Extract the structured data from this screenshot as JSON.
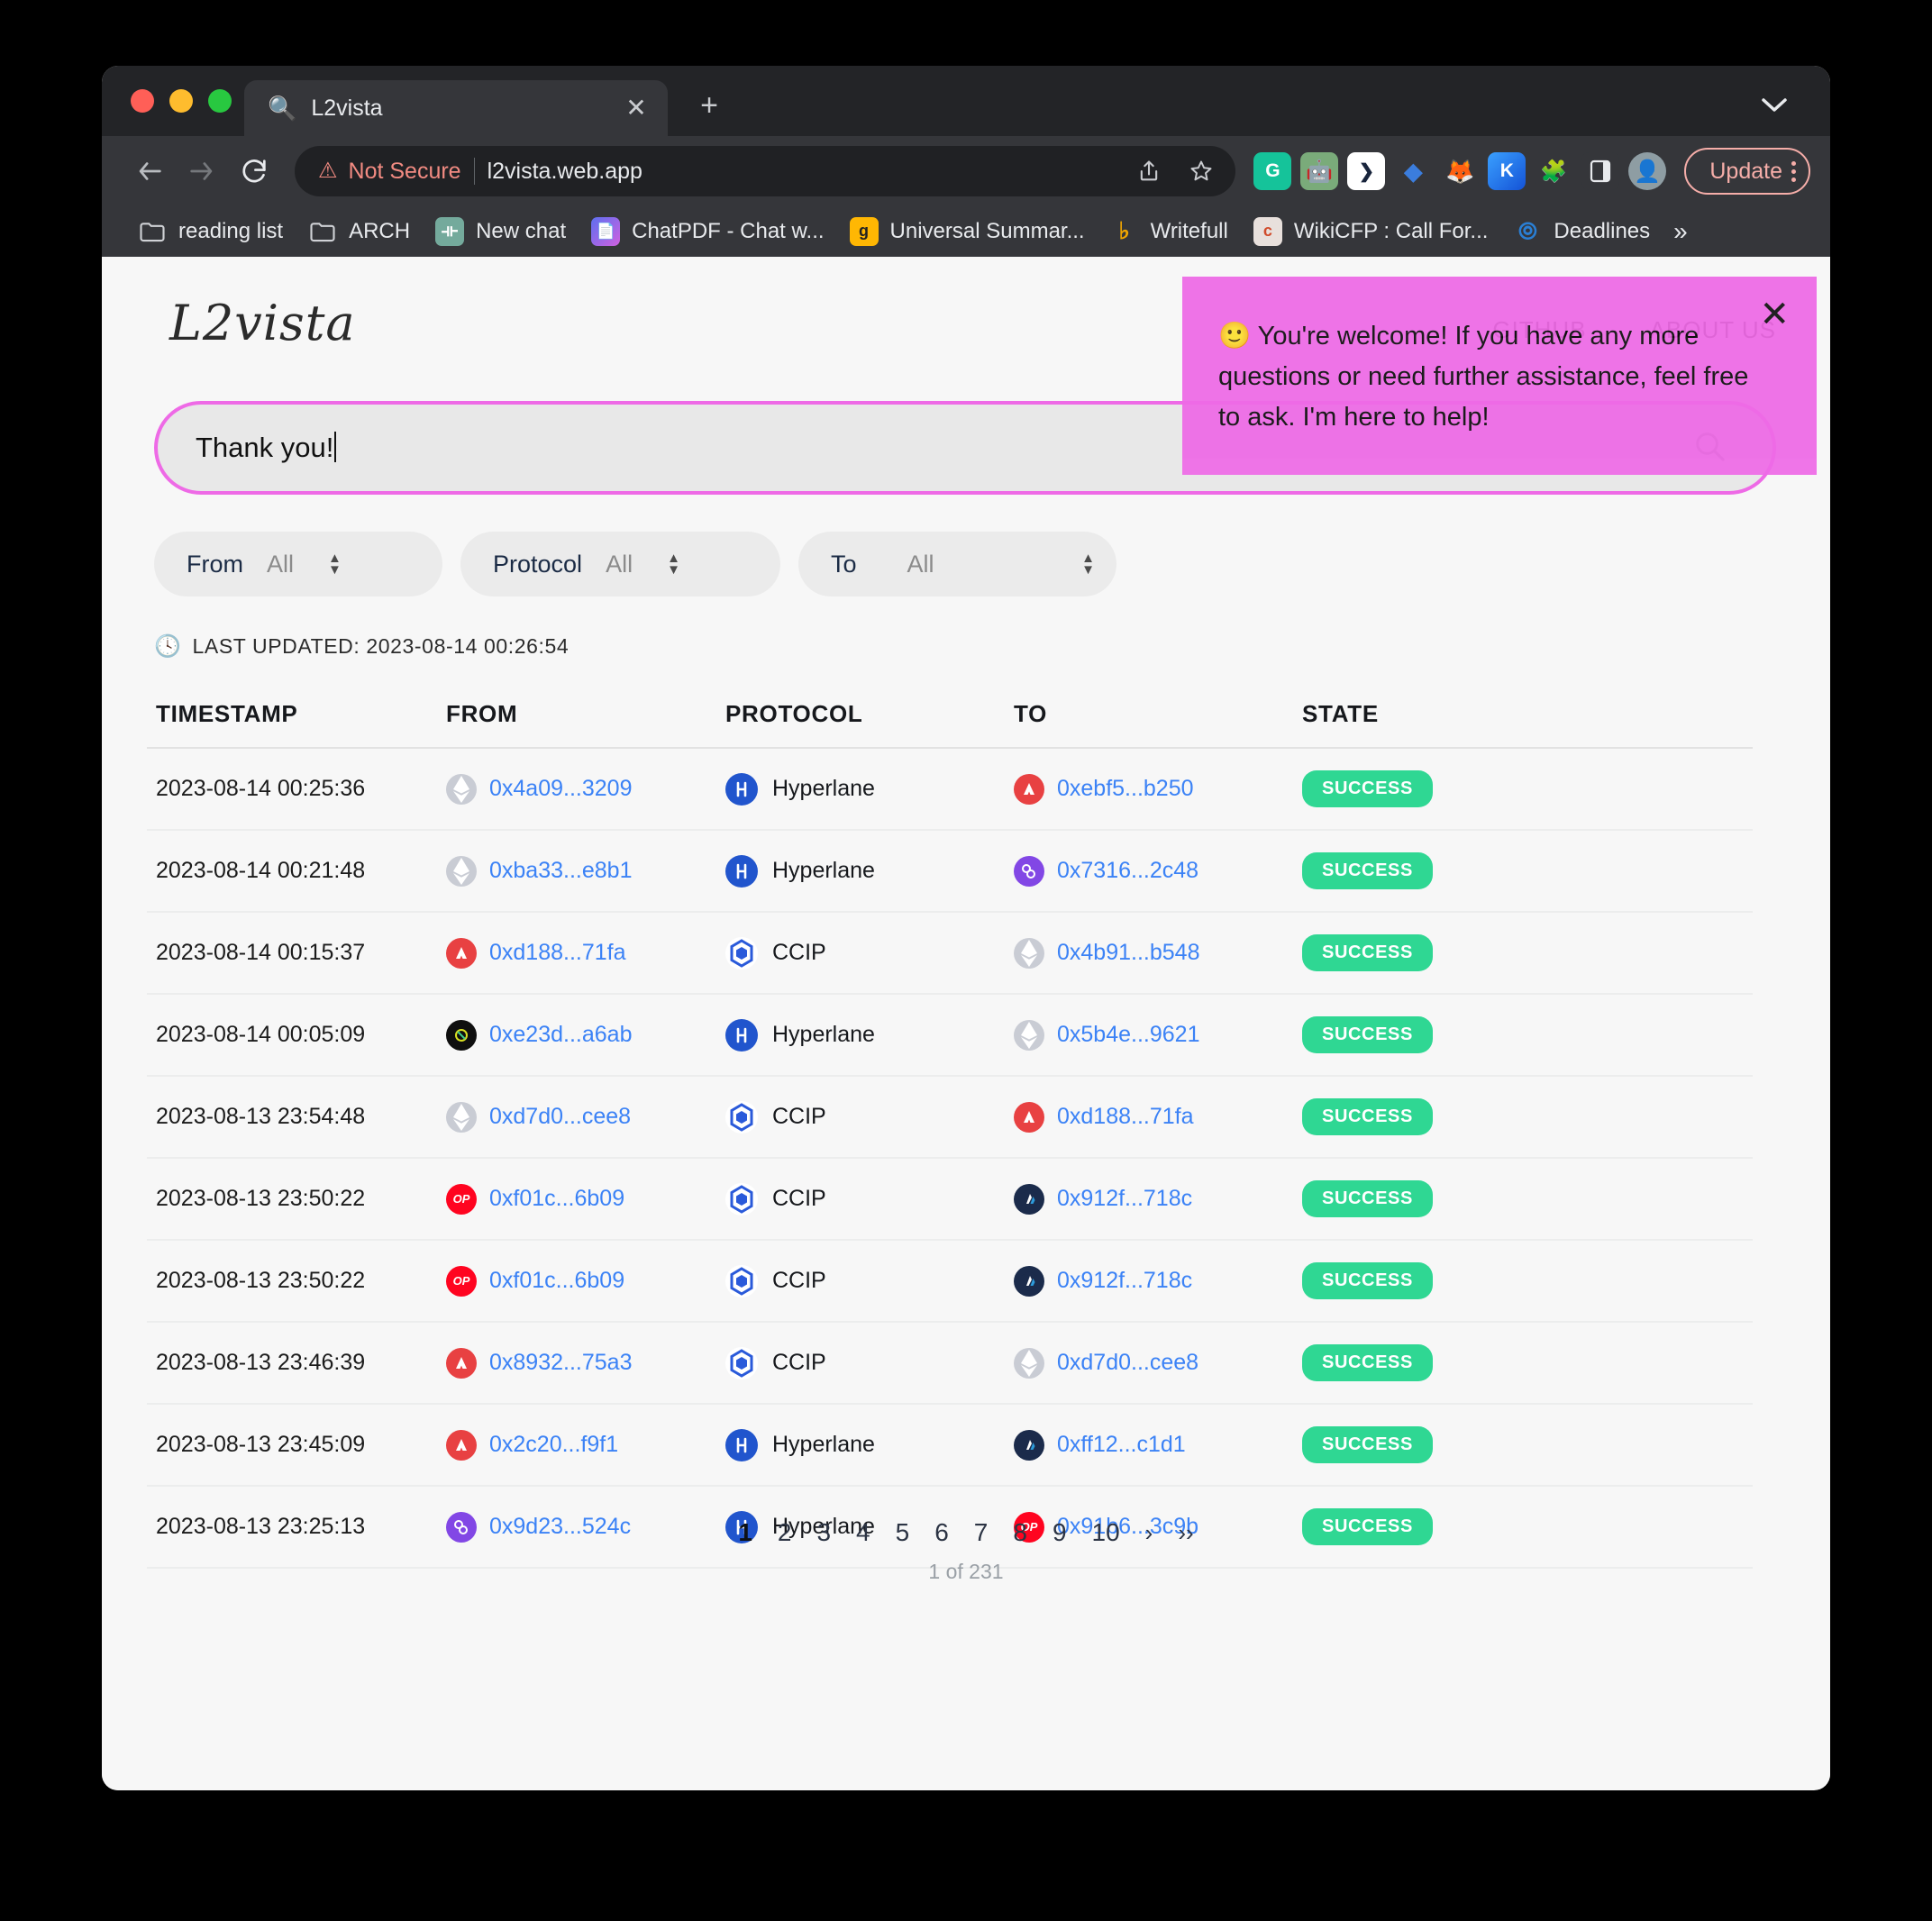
{
  "browser": {
    "tab": {
      "title": "L2vista",
      "favicon": "magnifier-icon",
      "close_label": "✕"
    },
    "new_tab_label": "+",
    "omnibox": {
      "security_label": "Not Secure",
      "warning_icon": "⚠",
      "url": "l2vista.web.app"
    },
    "nav": {
      "back": "←",
      "forward": "→",
      "reload": "↻"
    },
    "update_button": "Update",
    "extensions": [
      {
        "name": "grammarly-extension",
        "glyph": "G",
        "bg": "#15c39a"
      },
      {
        "name": "chatbot-extension",
        "glyph": "🤖",
        "bg": "#6aa06a"
      },
      {
        "name": "scribe-extension",
        "glyph": "❯",
        "bg": "#ffffff",
        "fg": "#1c2b4a"
      },
      {
        "name": "diamond-extension",
        "glyph": "◆",
        "bg": "#35363a",
        "fg": "#3b7ddd"
      },
      {
        "name": "metamask-extension",
        "glyph": "🦊",
        "bg": "#35363a"
      },
      {
        "name": "kaggle-extension",
        "glyph": "K",
        "bg": "#2d7ff9"
      },
      {
        "name": "puzzle-extensions-icon",
        "glyph": "🧩",
        "bg": "#35363a"
      },
      {
        "name": "sidepanel-icon",
        "glyph": "▯",
        "bg": "#35363a"
      },
      {
        "name": "profile-avatar",
        "glyph": "👤",
        "bg": "#8a9aa0"
      }
    ],
    "bookmarks": [
      {
        "label": "reading list",
        "icon": "folder-icon",
        "glyph": "🗀",
        "bg": "transparent"
      },
      {
        "label": "ARCH",
        "icon": "folder-icon",
        "glyph": "🗀",
        "bg": "transparent"
      },
      {
        "label": "New chat",
        "icon": "openai-icon",
        "glyph": "⊛",
        "bg": "#74aa9c"
      },
      {
        "label": "ChatPDF - Chat w...",
        "icon": "chatpdf-icon",
        "glyph": "📄",
        "bg": "#c86bdc"
      },
      {
        "label": "Universal Summar...",
        "icon": "glasp-icon",
        "glyph": "g",
        "bg": "#ffb703"
      },
      {
        "label": "Writefull",
        "icon": "writefull-icon",
        "glyph": "W",
        "bg": "#f0a500"
      },
      {
        "label": "WikiCFP : Call For...",
        "icon": "wikicfp-icon",
        "glyph": "c",
        "bg": "#e8e0dc"
      },
      {
        "label": "Deadlines",
        "icon": "deadlines-icon",
        "glyph": "◆",
        "bg": "#2a7fd4"
      }
    ],
    "bookmarks_overflow": "»"
  },
  "site": {
    "brand": "L2vista",
    "nav": [
      "GITHUB",
      "ABOUT US"
    ],
    "search": {
      "value": "Thank you!",
      "icon": "search-icon"
    },
    "filters": [
      {
        "label": "From",
        "value": "All"
      },
      {
        "label": "Protocol",
        "value": "All"
      },
      {
        "label": "To",
        "value": "All"
      }
    ],
    "last_updated": "LAST UPDATED: 2023-08-14 00:26:54",
    "clock_icon": "🕓"
  },
  "table": {
    "columns": [
      "TIMESTAMP",
      "FROM",
      "PROTOCOL",
      "TO",
      "STATE"
    ],
    "rows": [
      {
        "timestamp": "2023-08-14 00:25:36",
        "from": {
          "addr": "0x4a09...3209",
          "chain": "ethereum"
        },
        "protocol": {
          "name": "Hyperlane",
          "icon": "hyperlane-icon"
        },
        "to": {
          "addr": "0xebf5...b250",
          "chain": "avalanche"
        },
        "state": "SUCCESS"
      },
      {
        "timestamp": "2023-08-14 00:21:48",
        "from": {
          "addr": "0xba33...e8b1",
          "chain": "ethereum"
        },
        "protocol": {
          "name": "Hyperlane",
          "icon": "hyperlane-icon"
        },
        "to": {
          "addr": "0x7316...2c48",
          "chain": "polygon"
        },
        "state": "SUCCESS"
      },
      {
        "timestamp": "2023-08-14 00:15:37",
        "from": {
          "addr": "0xd188...71fa",
          "chain": "avalanche"
        },
        "protocol": {
          "name": "CCIP",
          "icon": "ccip-icon"
        },
        "to": {
          "addr": "0x4b91...b548",
          "chain": "ethereum"
        },
        "state": "SUCCESS"
      },
      {
        "timestamp": "2023-08-14 00:05:09",
        "from": {
          "addr": "0xe23d...a6ab",
          "chain": "gnosis"
        },
        "protocol": {
          "name": "Hyperlane",
          "icon": "hyperlane-icon"
        },
        "to": {
          "addr": "0x5b4e...9621",
          "chain": "ethereum"
        },
        "state": "SUCCESS"
      },
      {
        "timestamp": "2023-08-13 23:54:48",
        "from": {
          "addr": "0xd7d0...cee8",
          "chain": "ethereum"
        },
        "protocol": {
          "name": "CCIP",
          "icon": "ccip-icon"
        },
        "to": {
          "addr": "0xd188...71fa",
          "chain": "avalanche"
        },
        "state": "SUCCESS"
      },
      {
        "timestamp": "2023-08-13 23:50:22",
        "from": {
          "addr": "0xf01c...6b09",
          "chain": "optimism"
        },
        "protocol": {
          "name": "CCIP",
          "icon": "ccip-icon"
        },
        "to": {
          "addr": "0x912f...718c",
          "chain": "arbitrum"
        },
        "state": "SUCCESS"
      },
      {
        "timestamp": "2023-08-13 23:50:22",
        "from": {
          "addr": "0xf01c...6b09",
          "chain": "optimism"
        },
        "protocol": {
          "name": "CCIP",
          "icon": "ccip-icon"
        },
        "to": {
          "addr": "0x912f...718c",
          "chain": "arbitrum"
        },
        "state": "SUCCESS"
      },
      {
        "timestamp": "2023-08-13 23:46:39",
        "from": {
          "addr": "0x8932...75a3",
          "chain": "avalanche"
        },
        "protocol": {
          "name": "CCIP",
          "icon": "ccip-icon"
        },
        "to": {
          "addr": "0xd7d0...cee8",
          "chain": "ethereum"
        },
        "state": "SUCCESS"
      },
      {
        "timestamp": "2023-08-13 23:45:09",
        "from": {
          "addr": "0x2c20...f9f1",
          "chain": "avalanche"
        },
        "protocol": {
          "name": "Hyperlane",
          "icon": "hyperlane-icon"
        },
        "to": {
          "addr": "0xff12...c1d1",
          "chain": "arbitrum"
        },
        "state": "SUCCESS"
      },
      {
        "timestamp": "2023-08-13 23:25:13",
        "from": {
          "addr": "0x9d23...524c",
          "chain": "polygon"
        },
        "protocol": {
          "name": "Hyperlane",
          "icon": "hyperlane-icon"
        },
        "to": {
          "addr": "0x91b6...3c9b",
          "chain": "optimism"
        },
        "state": "SUCCESS"
      }
    ]
  },
  "pagination": {
    "pages": [
      "1",
      "2",
      "3",
      "4",
      "5",
      "6",
      "7",
      "8",
      "9",
      "10"
    ],
    "active": "1",
    "next": "›",
    "last": "››",
    "count_label": "1 of 231"
  },
  "chat_popup": {
    "text": "🙂 You're welcome! If you have any more questions or need further assistance, feel free to ask. I'm here to help!",
    "close": "✕"
  },
  "colors": {
    "accent_pink": "#ee6ae6",
    "link_blue": "#3b82f6",
    "success_green": "#2fd793",
    "not_secure_red": "#f28b82"
  }
}
